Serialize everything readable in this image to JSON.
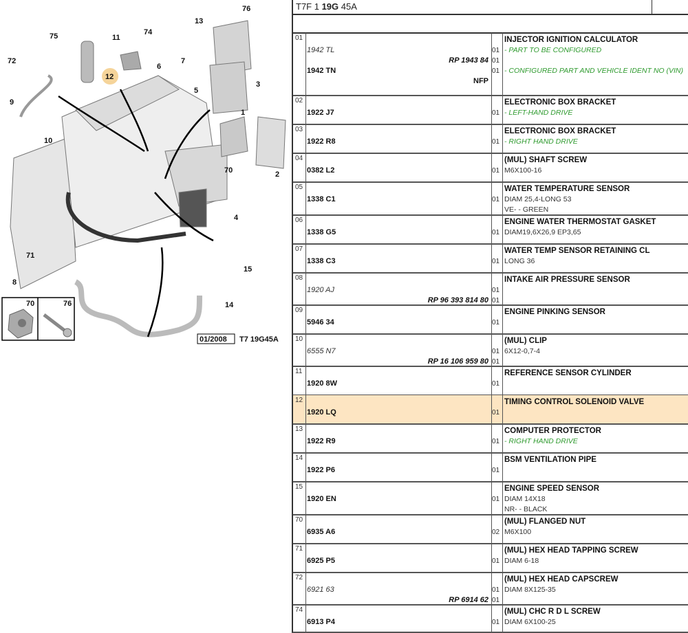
{
  "header": {
    "code_prefix": "T7F 1 ",
    "code_bold": "19G",
    "code_suffix": " 45A"
  },
  "diagram": {
    "date_box": "01/2008",
    "drawing_ref": "T7 19G45A",
    "inset_labels": [
      "70",
      "76"
    ],
    "highlight_color": "#f5d49a",
    "callouts": [
      "76",
      "13",
      "75",
      "11",
      "74",
      "72",
      "7",
      "6",
      "12",
      "3",
      "5",
      "9",
      "1",
      "10",
      "70",
      "2",
      "4",
      "71",
      "15",
      "8",
      "14"
    ]
  },
  "colors": {
    "highlight_row": "#fde5c2",
    "note_green": "#2e9a2e"
  },
  "rows": [
    {
      "num": "01",
      "lines": [
        {
          "desc": "INJECTOR IGNITION CALCULATOR",
          "ds": "b"
        },
        {
          "ref": "1942 TL",
          "rs": "i",
          "qty": "01",
          "desc": "- PART TO BE CONFIGURED",
          "ds": "g"
        },
        {
          "ref": "RP 1943 84",
          "rs": "r",
          "qty": "01"
        },
        {
          "ref": "1942 TN",
          "rs": "b",
          "qty": "01",
          "desc": "- CONFIGURED PART AND VEHICLE IDENT NO (VIN)",
          "ds": "g"
        },
        {
          "ref": "NFP",
          "rs": "n"
        }
      ]
    },
    {
      "num": "02",
      "lines": [
        {
          "desc": "ELECTRONIC BOX BRACKET",
          "ds": "b"
        },
        {
          "ref": "1922 J7",
          "rs": "b",
          "qty": "01",
          "desc": "- LEFT-HAND DRIVE",
          "ds": "g"
        }
      ]
    },
    {
      "num": "03",
      "lines": [
        {
          "desc": "ELECTRONIC BOX BRACKET",
          "ds": "b"
        },
        {
          "ref": "1922 R8",
          "rs": "b",
          "qty": "01",
          "desc": "- RIGHT HAND DRIVE",
          "ds": "g"
        }
      ]
    },
    {
      "num": "04",
      "lines": [
        {
          "desc": "(MUL) SHAFT SCREW",
          "ds": "b"
        },
        {
          "ref": "0382 L2",
          "rs": "b",
          "qty": "01",
          "desc": "M6X100-16"
        }
      ]
    },
    {
      "num": "05",
      "lines": [
        {
          "desc": "WATER TEMPERATURE SENSOR",
          "ds": "b"
        },
        {
          "ref": "1338 C1",
          "rs": "b",
          "qty": "01",
          "desc": "DIAM 25,4-LONG 53"
        },
        {
          "desc": "VE- - GREEN"
        }
      ]
    },
    {
      "num": "06",
      "lines": [
        {
          "desc": "ENGINE WATER THERMOSTAT GASKET",
          "ds": "b"
        },
        {
          "ref": "1338 G5",
          "rs": "b",
          "qty": "01",
          "desc": "DIAM19,6X26,9 EP3,65"
        }
      ]
    },
    {
      "num": "07",
      "lines": [
        {
          "desc": "WATER TEMP SENSOR RETAINING CL",
          "ds": "b"
        },
        {
          "ref": "1338 C3",
          "rs": "b",
          "qty": "01",
          "desc": "LONG 36"
        }
      ]
    },
    {
      "num": "08",
      "lines": [
        {
          "desc": "INTAKE AIR PRESSURE SENSOR",
          "ds": "b"
        },
        {
          "ref": "1920 AJ",
          "rs": "i",
          "qty": "01"
        },
        {
          "ref": "RP 96 393 814 80",
          "rs": "r",
          "qty": "01"
        }
      ]
    },
    {
      "num": "09",
      "lines": [
        {
          "desc": "ENGINE PINKING SENSOR",
          "ds": "b"
        },
        {
          "ref": "5946 34",
          "rs": "b",
          "qty": "01"
        }
      ]
    },
    {
      "num": "10",
      "lines": [
        {
          "desc": "(MUL) CLIP",
          "ds": "b"
        },
        {
          "ref": "6555 N7",
          "rs": "i",
          "qty": "01",
          "desc": "6X12-0,7-4"
        },
        {
          "ref": "RP 16 106 959 80",
          "rs": "r",
          "qty": "01"
        }
      ]
    },
    {
      "num": "11",
      "lines": [
        {
          "desc": "REFERENCE SENSOR CYLINDER",
          "ds": "b"
        },
        {
          "ref": "1920 8W",
          "rs": "b",
          "qty": "01"
        }
      ]
    },
    {
      "num": "12",
      "highlight": true,
      "lines": [
        {
          "desc": "TIMING CONTROL SOLENOID VALVE",
          "ds": "b"
        },
        {
          "ref": "1920 LQ",
          "rs": "b",
          "qty": "01"
        }
      ]
    },
    {
      "num": "13",
      "lines": [
        {
          "desc": "COMPUTER PROTECTOR",
          "ds": "b"
        },
        {
          "ref": "1922 R9",
          "rs": "b",
          "qty": "01",
          "desc": "- RIGHT HAND DRIVE",
          "ds": "g"
        }
      ]
    },
    {
      "num": "14",
      "lines": [
        {
          "desc": "BSM VENTILATION PIPE",
          "ds": "b"
        },
        {
          "ref": "1922 P6",
          "rs": "b",
          "qty": "01"
        }
      ]
    },
    {
      "num": "15",
      "lines": [
        {
          "desc": "ENGINE SPEED SENSOR",
          "ds": "b"
        },
        {
          "ref": "1920 EN",
          "rs": "b",
          "qty": "01",
          "desc": "DIAM 14X18"
        },
        {
          "desc": "NR- - BLACK"
        }
      ]
    },
    {
      "num": "70",
      "lines": [
        {
          "desc": "(MUL) FLANGED NUT",
          "ds": "b"
        },
        {
          "ref": "6935 A6",
          "rs": "b",
          "qty": "02",
          "desc": "M6X100"
        }
      ]
    },
    {
      "num": "71",
      "lines": [
        {
          "desc": "(MUL) HEX HEAD TAPPING SCREW",
          "ds": "b"
        },
        {
          "ref": "6925 P5",
          "rs": "b",
          "qty": "01",
          "desc": "DIAM 6-18"
        }
      ]
    },
    {
      "num": "72",
      "lines": [
        {
          "desc": "(MUL) HEX HEAD CAPSCREW",
          "ds": "b"
        },
        {
          "ref": "6921 63",
          "rs": "i",
          "qty": "01",
          "desc": "DIAM 8X125-35"
        },
        {
          "ref": "RP 6914 62",
          "rs": "r",
          "qty": "01"
        }
      ]
    },
    {
      "num": "74",
      "lines": [
        {
          "desc": "(MUL) CHC R D L SCREW",
          "ds": "b"
        },
        {
          "ref": "6913 P4",
          "rs": "b",
          "qty": "01",
          "desc": "DIAM 6X100-25"
        }
      ]
    }
  ]
}
